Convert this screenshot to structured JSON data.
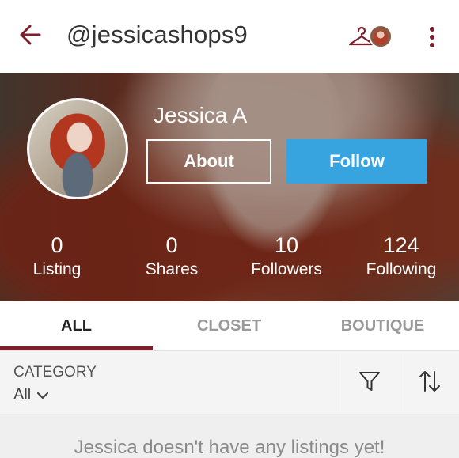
{
  "header": {
    "handle": "@jessicashops9",
    "back_icon": "arrow-left-icon",
    "closet_icon": "hanger-icon",
    "menu_icon": "more-vertical-icon",
    "accent_color": "#7a1f2b"
  },
  "profile": {
    "display_name": "Jessica A",
    "about_label": "About",
    "follow_label": "Follow",
    "follow_color": "#37a3df"
  },
  "stats": [
    {
      "value": "0",
      "label": "Listing"
    },
    {
      "value": "0",
      "label": "Shares"
    },
    {
      "value": "10",
      "label": "Followers"
    },
    {
      "value": "124",
      "label": "Following"
    }
  ],
  "tabs": [
    {
      "label": "ALL",
      "active": true
    },
    {
      "label": "CLOSET",
      "active": false
    },
    {
      "label": "BOUTIQUE",
      "active": false
    }
  ],
  "filter": {
    "category_caption": "CATEGORY",
    "category_value": "All",
    "filter_icon": "funnel-icon",
    "sort_icon": "sort-arrows-icon"
  },
  "empty_state": {
    "message": "Jessica doesn't have any listings yet!"
  }
}
